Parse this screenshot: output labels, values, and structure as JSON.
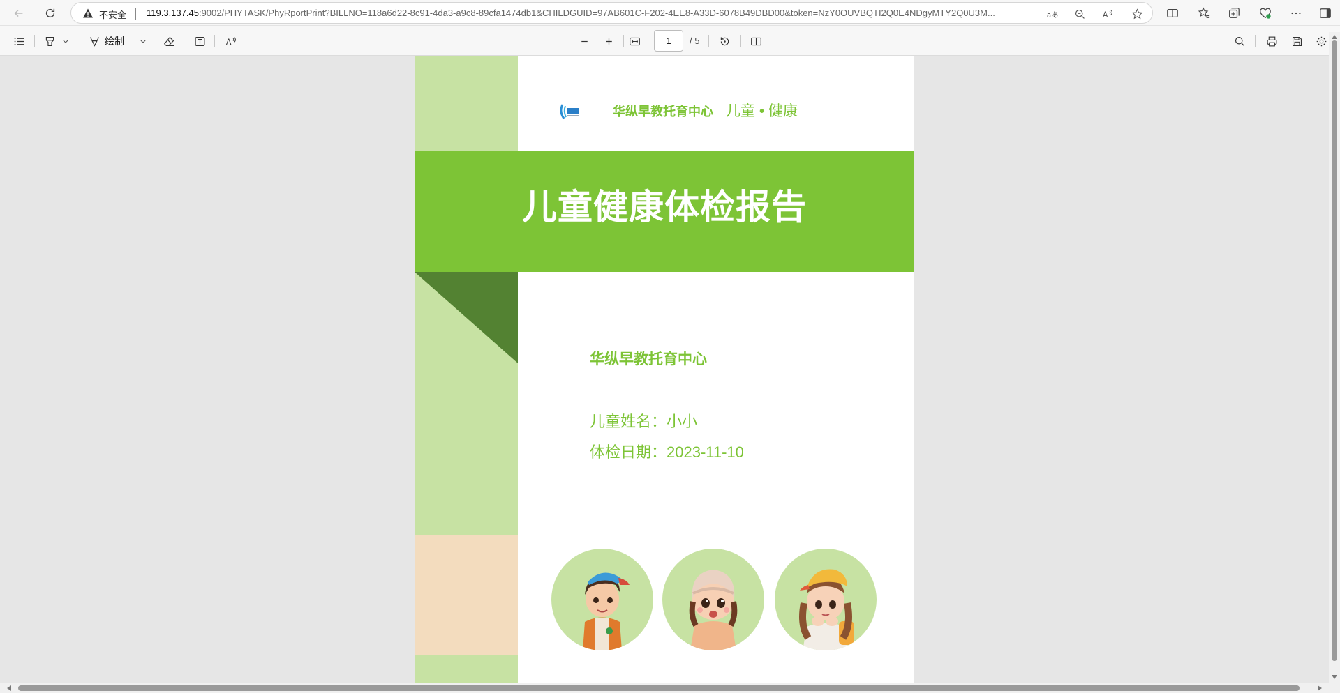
{
  "browser": {
    "insecure_label": "不安全",
    "url_host": "119.3.137.45",
    "url_rest": ":9002/PHYTASK/PhyRportPrint?BILLNO=118a6d22-8c91-4da3-a9c8-89cfa1474db1&CHILDGUID=97AB601C-F202-4EE8-A33D-6078B49DBD00&token=NzY0OUVBQTI2Q0E4NDgyMTY2Q0U3M..."
  },
  "pdf_toolbar": {
    "draw_label": "绘制",
    "current_page": "1",
    "total_pages": "/ 5"
  },
  "report": {
    "header_org": "华纵早教托育中心",
    "header_slogan": "儿童 • 健康",
    "title": "儿童健康体检报告",
    "org_name": "华纵早教托育中心",
    "child_name_line": "儿童姓名：小小",
    "exam_date_line": "体检日期：2023-11-10"
  },
  "colors": {
    "brand_green": "#7dc436",
    "light_green": "#c7e2a3",
    "dark_green": "#538232",
    "peach": "#f3dcbe"
  },
  "icons": {
    "back": "back-arrow-icon",
    "refresh": "refresh-icon",
    "warning": "warning-icon",
    "favorite": "star-icon",
    "settings": "gear-icon"
  }
}
